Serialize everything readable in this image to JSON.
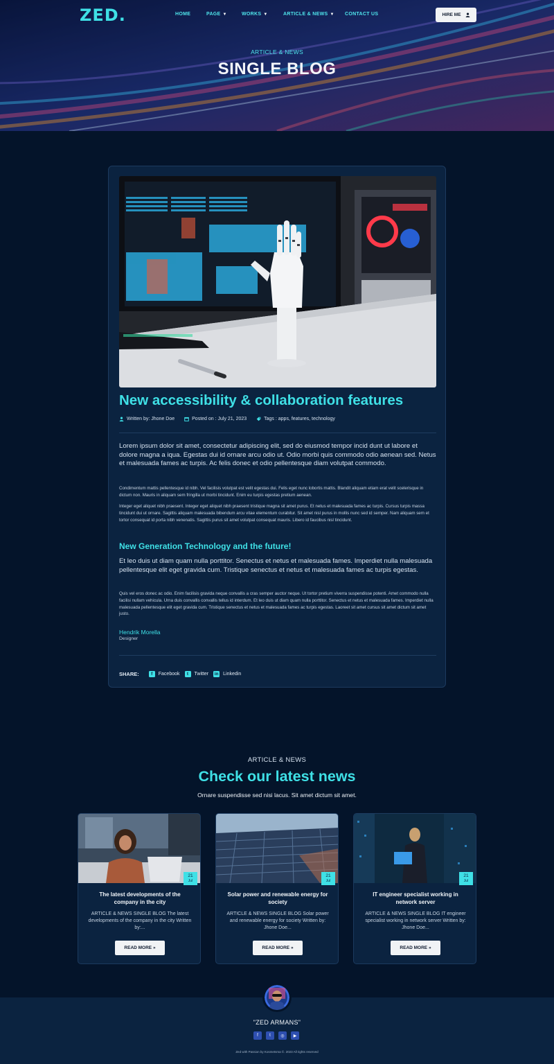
{
  "header": {
    "logo": "ZED.",
    "nav": [
      {
        "label": "HOME",
        "dropdown": false
      },
      {
        "label": "PAGE",
        "dropdown": true
      },
      {
        "label": "WORKS",
        "dropdown": true
      },
      {
        "label": "ARTICLE & NEWS",
        "dropdown": true
      },
      {
        "label": "CONTACT US",
        "dropdown": false
      }
    ],
    "hire_label": "HIRE ME"
  },
  "hero": {
    "subtitle": "ARTICLE & NEWS",
    "title": "SINGLE BLOG"
  },
  "article": {
    "title": "New accessibility & collaboration features",
    "meta": {
      "author": "Written by: Jhone Doe",
      "posted": "Posted on : July 21, 2023",
      "tags": "Tags : apps, features, technology"
    },
    "lead_1": "Lorem ipsum dolor sit amet, consectetur adipiscing elit, sed do eiusmod tempor incid dunt ut labore et dolore magna a iqua. Egestas dui id ornare arcu odio ut. Odio morbi quis commodo odio aenean sed. Netus et malesuada fames ac turpis. Ac felis donec et odio pellentesque diam volutpat commodo.",
    "para_1": "Condimentum mattis pellentesque id nibh. Vel facilisis volutpat est velit egestas dui. Felis eget nunc lobortis mattis. Blandit aliquam etiam erat velit scelerisque in dictum non. Mauris in aliquam sem fringilla ut morbi tincidunt. Enim eu turpis egestas pretium aenean.",
    "para_2": "Integer eget aliquet nibh praesent. Integer eget aliquet nibh praesent tristique magna sit amet purus. Et netus et malesuada fames ac turpis. Cursus turpis massa tincidunt dui ut ornare. Sagittis aliquam malesuada bibendum arcu vitae elementum curabitur. Sit amet nisl purus in mollis nunc sed id semper. Nam aliquam sem et tortor consequat id porta nibh venenatis. Sagittis purus sit amet volutpat consequat mauris. Libero id faucibus nisl tincidunt.",
    "subheading": "New Generation Technology and the future!",
    "lead_2": "Et leo duis ut diam quam nulla porttitor. Senectus et netus et malesuada fames. Imperdiet nulla malesuada pellentesque elit eget gravida cum. Tristique senectus et netus et malesuada fames ac turpis egestas.",
    "para_3": "Quis vel eros donec ac odio. Enim facilisis gravida neque convallis a cras semper auctor neque. Ut tortor pretium viverra suspendisse potenti. Amet commodo nulla facilisi nullam vehicula. Urna duis convallis convallis tellus id interdum. Et leo duis ut diam quam nulla porttitor. Senectus et netus et malesuada fames. Imperdiet nulla malesuada pellentesque elit eget gravida cum. Tristique senectus et netus et malesuada fames ac turpis egestas. Laoreet sit amet cursus sit amet dictum sit amet justo.",
    "author_name": "Hendrik Morella",
    "author_role": "Designer",
    "share": {
      "label": "SHARE:",
      "items": [
        {
          "label": "Facebook",
          "icon": "facebook-icon"
        },
        {
          "label": "Twitter",
          "icon": "twitter-icon"
        },
        {
          "label": "Linkedin",
          "icon": "linkedin-icon"
        }
      ]
    }
  },
  "news": {
    "kicker": "ARTICLE & NEWS",
    "title": "Check our latest news",
    "subtitle": "Ornare suspendisse sed nisi lacus. Sit amet dictum sit amet.",
    "cards": [
      {
        "day": "21",
        "month": "Jul",
        "title": "The latest developments of the company in the city",
        "excerpt": "ARTICLE & NEWS SINGLE BLOG The latest developments of the company in the city Written by:...",
        "button": "READ MORE »"
      },
      {
        "day": "21",
        "month": "Jul",
        "title": "Solar power and renewable energy for society",
        "excerpt": "ARTICLE & NEWS SINGLE BLOG Solar power and renewable energy for society Written by: Jhone Doe...",
        "button": "READ MORE »"
      },
      {
        "day": "21",
        "month": "Jul",
        "title": "IT engineer specialist working in network server",
        "excerpt": "ARTICLE & NEWS SINGLE BLOG IT engineer specialist working in network server Written by: Jhone Doe...",
        "button": "READ MORE »"
      }
    ]
  },
  "footer": {
    "name": "\"ZED ARMANS\"",
    "socials": [
      "facebook-icon",
      "twitter-icon",
      "instagram-icon",
      "youtube-icon"
    ],
    "copyright": "Zed with Passion by Kosmetsma ©. 2023 All rights reserved"
  },
  "colors": {
    "accent": "#3fe0e6",
    "background": "#04142a",
    "card": "#0b2340"
  }
}
